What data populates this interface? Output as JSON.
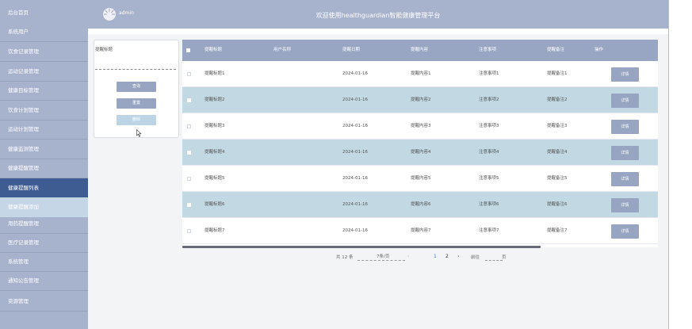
{
  "sidebar": {
    "items": [
      {
        "label": "后台首页"
      },
      {
        "label": "系统用户"
      },
      {
        "label": "饮食记录管理"
      },
      {
        "label": "运动记录管理"
      },
      {
        "label": "健康目标管理"
      },
      {
        "label": "饮食计划管理"
      },
      {
        "label": "运动计划管理"
      },
      {
        "label": "健康监测管理"
      },
      {
        "label": "健康提醒管理"
      },
      {
        "label": "健康提醒列表"
      },
      {
        "label": "健康提醒添加"
      },
      {
        "label": "用药提醒管理"
      },
      {
        "label": "医疗记录管理"
      },
      {
        "label": "系统管理"
      },
      {
        "label": "通知公告管理"
      },
      {
        "label": "资源管理"
      }
    ]
  },
  "header": {
    "user": "admin",
    "title": "欢迎使用healthguardian智能健康管理平台"
  },
  "search_panel": {
    "field_label": "提醒标题",
    "buttons": {
      "search": "查询",
      "reset": "重置",
      "delete": "删除"
    }
  },
  "table": {
    "headers": [
      "提醒标题",
      "用户名称",
      "提醒日期",
      "提醒内容",
      "注意事项",
      "提醒备注",
      "操作"
    ],
    "detail_label": "详情",
    "rows": [
      {
        "title": "提醒标题1",
        "user": "",
        "date": "2024-01-16",
        "content": "提醒内容1",
        "notes": "注意事项1",
        "remark": "提醒备注1"
      },
      {
        "title": "提醒标题2",
        "user": "",
        "date": "2024-01-16",
        "content": "提醒内容2",
        "notes": "注意事项2",
        "remark": "提醒备注2"
      },
      {
        "title": "提醒标题3",
        "user": "",
        "date": "2024-01-16",
        "content": "提醒内容3",
        "notes": "注意事项3",
        "remark": "提醒备注3"
      },
      {
        "title": "提醒标题4",
        "user": "",
        "date": "2024-01-16",
        "content": "提醒内容4",
        "notes": "注意事项4",
        "remark": "提醒备注4"
      },
      {
        "title": "提醒标题5",
        "user": "",
        "date": "2024-01-16",
        "content": "提醒内容5",
        "notes": "注意事项5",
        "remark": "提醒备注5"
      },
      {
        "title": "提醒标题6",
        "user": "",
        "date": "2024-01-16",
        "content": "提醒内容6",
        "notes": "注意事项6",
        "remark": "提醒备注6"
      },
      {
        "title": "提醒标题7",
        "user": "",
        "date": "2024-01-16",
        "content": "提醒内容7",
        "notes": "注意事项7",
        "remark": "提醒备注7"
      }
    ]
  },
  "pagination": {
    "total": "共 12 条",
    "page_size": "7条/页",
    "prev": "‹",
    "pages": [
      "1",
      "2"
    ],
    "next": "›",
    "goto_prefix": "前往",
    "goto_suffix": "页"
  },
  "colors": {
    "sidebar": "#a7b2cc",
    "active": "#3e5b92",
    "table_header": "#98a6c3",
    "stripe": "#c2d9e4",
    "button": "#97a5c2"
  }
}
